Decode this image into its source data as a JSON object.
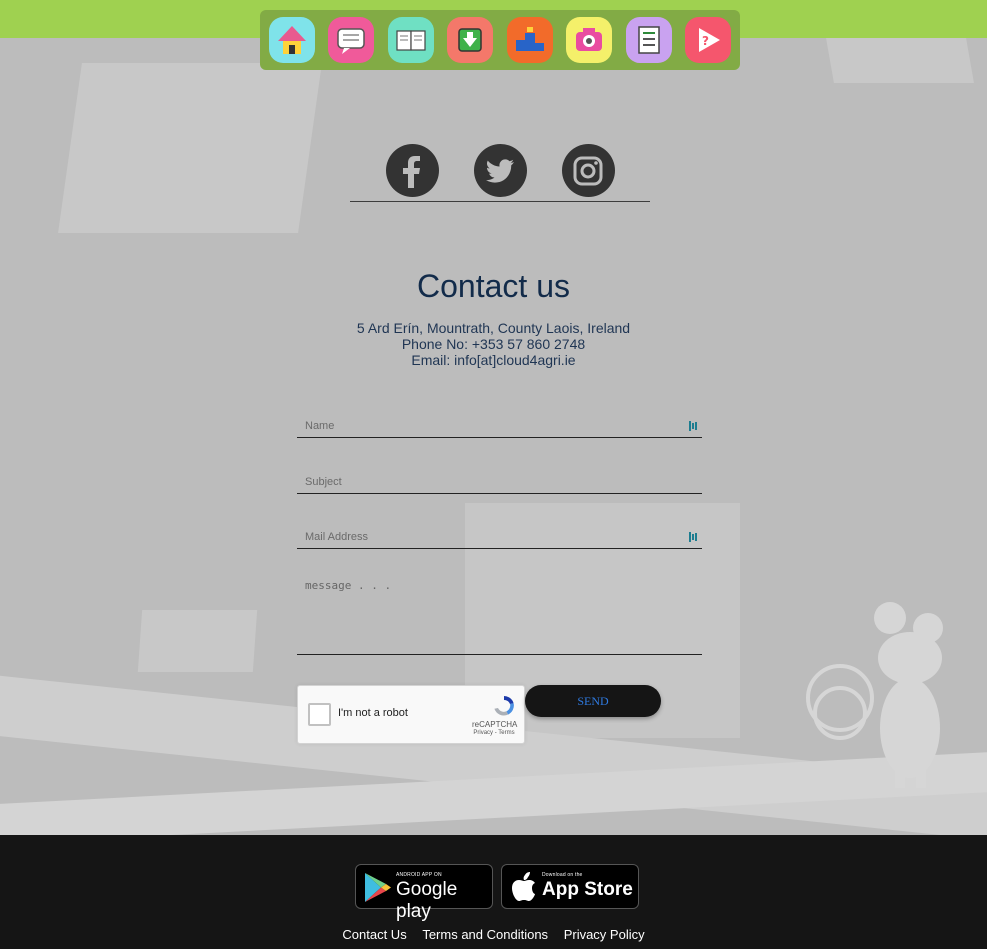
{
  "nav": {
    "apps": [
      {
        "name": "home-app",
        "bg": "#7fe3ea"
      },
      {
        "name": "chat-app",
        "bg": "#f05a9a"
      },
      {
        "name": "reader-app",
        "bg": "#6fe0c3"
      },
      {
        "name": "download-app",
        "bg": "#f4786a"
      },
      {
        "name": "podium-app",
        "bg": "#f26b2a"
      },
      {
        "name": "camera-app",
        "bg": "#f4f06a"
      },
      {
        "name": "checklist-app",
        "bg": "#c9a2f0"
      },
      {
        "name": "video-app",
        "bg": "#f5566d"
      }
    ]
  },
  "social": {
    "items": [
      "facebook-icon",
      "twitter-icon",
      "instagram-icon"
    ]
  },
  "contact": {
    "title": "Contact us",
    "address": "5 Ard Erín, Mountrath, County Laois, Ireland",
    "phone": "Phone No: +353 57 860 2748",
    "email": "Email: info[at]cloud4agri.ie"
  },
  "form": {
    "name_placeholder": "Name",
    "subject_placeholder": "Subject",
    "mail_placeholder": "Mail Address",
    "message_placeholder": "message . . .",
    "captcha_label": "I'm not a robot",
    "captcha_brand": "reCAPTCHA",
    "captcha_terms": "Privacy - Terms",
    "send_label": "SEND"
  },
  "footer": {
    "google_small": "ANDROID APP ON",
    "google_big": "Google play",
    "apple_small": "Download on the",
    "apple_big": "App Store",
    "links": [
      "Contact Us",
      "Terms and Conditions",
      "Privacy Policy"
    ]
  },
  "colors": {
    "topbar": "#9fd150",
    "title": "#122b4a",
    "send_text": "#2f7ae0",
    "footer": "#151515"
  }
}
